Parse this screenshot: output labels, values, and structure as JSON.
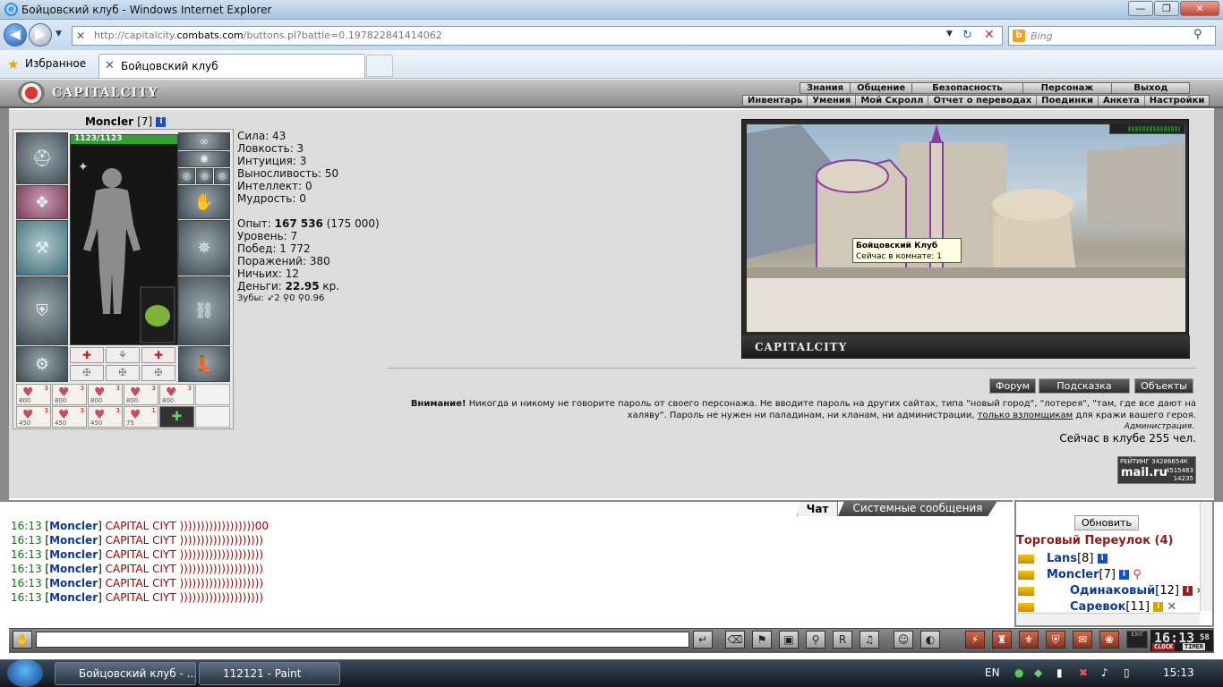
{
  "window": {
    "title": "Бойцовский клуб - Windows Internet Explorer",
    "min": "—",
    "max": "❐",
    "close": "✕"
  },
  "browser": {
    "url_prefix": "http://capitalcity.",
    "url_host": "combats.com",
    "url_path": "/buttons.pl?battle=0.197822841414062",
    "search_placeholder": "Bing",
    "favorites_label": "Избранное",
    "tab_label": "Бойцовский клуб"
  },
  "game": {
    "logo": "CAPITALCITY",
    "topnav": [
      "Знания",
      "Общение",
      "Безопасность",
      "Персонаж",
      "Выход"
    ],
    "subnav": [
      "Инвентарь",
      "Умения",
      "Мой Скролл",
      "Отчет о переводах",
      "Поединки",
      "Анкета",
      "Настройки"
    ]
  },
  "character": {
    "name": "Moncler",
    "level": "[7]",
    "hp": "1123/1123",
    "potions": [
      {
        "n": "3",
        "p": "800"
      },
      {
        "n": "3",
        "p": "800"
      },
      {
        "n": "3",
        "p": "800"
      },
      {
        "n": "3",
        "p": "800"
      },
      {
        "n": "3",
        "p": "800"
      },
      {
        "n": "3",
        "p": "450"
      },
      {
        "n": "3",
        "p": "450"
      },
      {
        "n": "3",
        "p": "450"
      },
      {
        "n": "1",
        "p": "75"
      }
    ]
  },
  "stats": {
    "lines1": [
      "Сила: 43",
      "Ловкость: 3",
      "Интуиция: 3",
      "Выносливость: 50",
      "Интеллект: 0",
      "Мудрость: 0"
    ],
    "exp_label": "Опыт: ",
    "exp_value": "167 536",
    "exp_next": " (175 000)",
    "lines2": [
      "Уровень: 7",
      "Побед: 1 772",
      "Поражений: 380",
      "Ничьих: 12"
    ],
    "money_label": "Деньги: ",
    "money_value": "22.95",
    "money_unit": " кр.",
    "teeth": "Зубы: ➶2 ⚲0 ⚲0.96"
  },
  "city": {
    "caption": "CAPITALCITY",
    "tooltip_title": "Бойцовский Клуб",
    "tooltip_text": "Сейчас в комнате: 1"
  },
  "buttons": {
    "forum": "Форум",
    "hint": "Подсказка",
    "objects": "Объекты"
  },
  "warning": {
    "bold": "Внимание!",
    "text1": " Никогда и никому не говорите пароль от своего персонажа. Не вводите пароль на других сайтах, типа \"новый город\", \"лотерея\", \"там, где все дают на халяву\". Пароль не нужен ни паладинам, ни кланам, ни администрации, ",
    "link": "только взломщикам",
    "text2": " для кражи вашего героя.",
    "admin": "Администрация.",
    "online": "Сейчас в клубе 255 чел."
  },
  "rating": {
    "line1": "РЕЙТИНГ 34286654К",
    "brand": "mail.ru",
    "n1": "4515463",
    "n2": "14235"
  },
  "chat": {
    "tab_chat": "Чат",
    "tab_system": "Системные сообщения",
    "messages": [
      {
        "time": "16:13",
        "nick": "Moncler",
        "text": "CAPITAL CIYT ))))))))))))))))))00"
      },
      {
        "time": "16:13",
        "nick": "Moncler",
        "text": "CAPITAL CIYT ))))))))))))))))))))"
      },
      {
        "time": "16:13",
        "nick": "Moncler",
        "text": "CAPITAL CIYT ))))))))))))))))))))"
      },
      {
        "time": "16:13",
        "nick": "Moncler",
        "text": "CAPITAL CIYT ))))))))))))))))))))"
      },
      {
        "time": "16:13",
        "nick": "Moncler",
        "text": "CAPITAL CIYT ))))))))))))))))))))"
      },
      {
        "time": "16:13",
        "nick": "Moncler",
        "text": "CAPITAL CIYT ))))))))))))))))))))"
      }
    ]
  },
  "room": {
    "refresh": "Обновить",
    "name": "Торговый Переулок (4)",
    "users": [
      {
        "nick": "Lans",
        "level": "[8]"
      },
      {
        "nick": "Moncler",
        "level": "[7]"
      },
      {
        "nick": "Одинаковый",
        "level": "[12]"
      },
      {
        "nick": "Саревок",
        "level": "[11]"
      }
    ]
  },
  "clock": {
    "time": "16:13",
    "sec": "58",
    "label1": "CLOCK",
    "label2": "TIMER",
    "exit": "EXIT"
  },
  "taskbar": {
    "tasks": [
      "Бойцовский клуб - ...",
      "112121 - Paint"
    ],
    "lang": "EN",
    "time": "15:13"
  },
  "colors": {
    "accent": "#1b4fbd",
    "hp": "#2da52d",
    "room": "#8b1a1a",
    "chat_text": "#a00000",
    "chat_time": "#008000"
  }
}
